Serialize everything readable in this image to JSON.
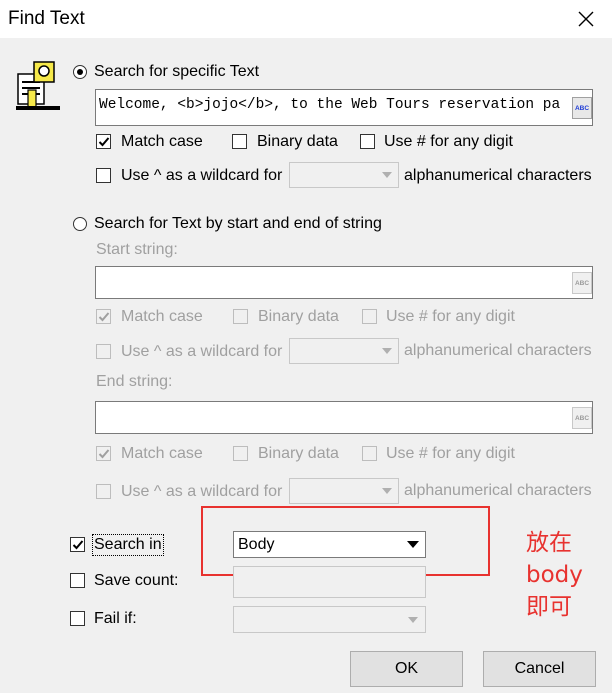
{
  "window": {
    "title": "Find Text"
  },
  "specific": {
    "radio_label": "Search for specific Text",
    "search_value": "Welcome, <b>jojo</b>, to the Web Tours reservation pa",
    "match_case_label": "Match case",
    "binary_data_label": "Binary data",
    "use_hash_label": "Use # for any digit",
    "wildcard_label": "Use ^ as a wildcard for",
    "alphanumerical_label": "alphanumerical characters"
  },
  "start_end": {
    "radio_label": "Search for Text by start and end of string",
    "start_label": "Start string:",
    "end_label": "End string:",
    "match_case_label": "Match case",
    "binary_data_label": "Binary data",
    "use_hash_label": "Use # for any digit",
    "wildcard_label": "Use ^ as a wildcard for",
    "alphanumerical_label": "alphanumerical characters"
  },
  "search_in": {
    "label": "Search in",
    "value": "Body"
  },
  "save_count": {
    "label": "Save count:"
  },
  "fail_if": {
    "label": "Fail if:"
  },
  "buttons": {
    "ok": "OK",
    "cancel": "Cancel",
    "abc": "ABC"
  },
  "annotation": {
    "line1": "放在",
    "line2": "body",
    "line3": "即可"
  },
  "icons": {
    "dialog": "find-text-icon",
    "close": "close-icon",
    "abc": "abc-editor-icon",
    "dropdown": "chevron-down-icon"
  },
  "colors": {
    "annotation": "#e8322f",
    "disabled_text": "#a0a0a0",
    "background": "#f0f0f0"
  }
}
